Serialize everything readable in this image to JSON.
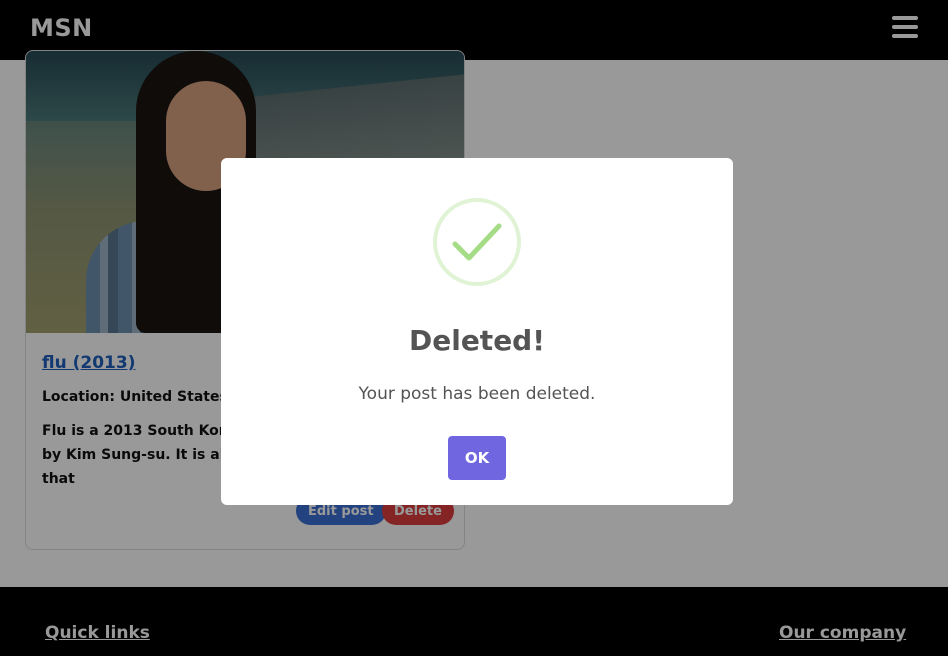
{
  "navbar": {
    "brand": "MSN"
  },
  "card": {
    "title": "flu (2013)",
    "location": "Location: United States",
    "description": "Flu is a 2013 South Korean disaster film directed by Kim Sung-su. It is about a deadly strain of H5N1 that",
    "edit_label": "Edit post",
    "delete_label": "Delete"
  },
  "footer": {
    "quick_links": "Quick links",
    "our_company": "Our company"
  },
  "modal": {
    "title": "Deleted!",
    "text": "Your post has been deleted.",
    "ok_label": "OK"
  },
  "colors": {
    "navbar": "#000000",
    "edit_button": "#3b6fd6",
    "delete_button": "#dc3c3c",
    "ok_button": "#7066e0",
    "success_check": "#a5dc86"
  }
}
